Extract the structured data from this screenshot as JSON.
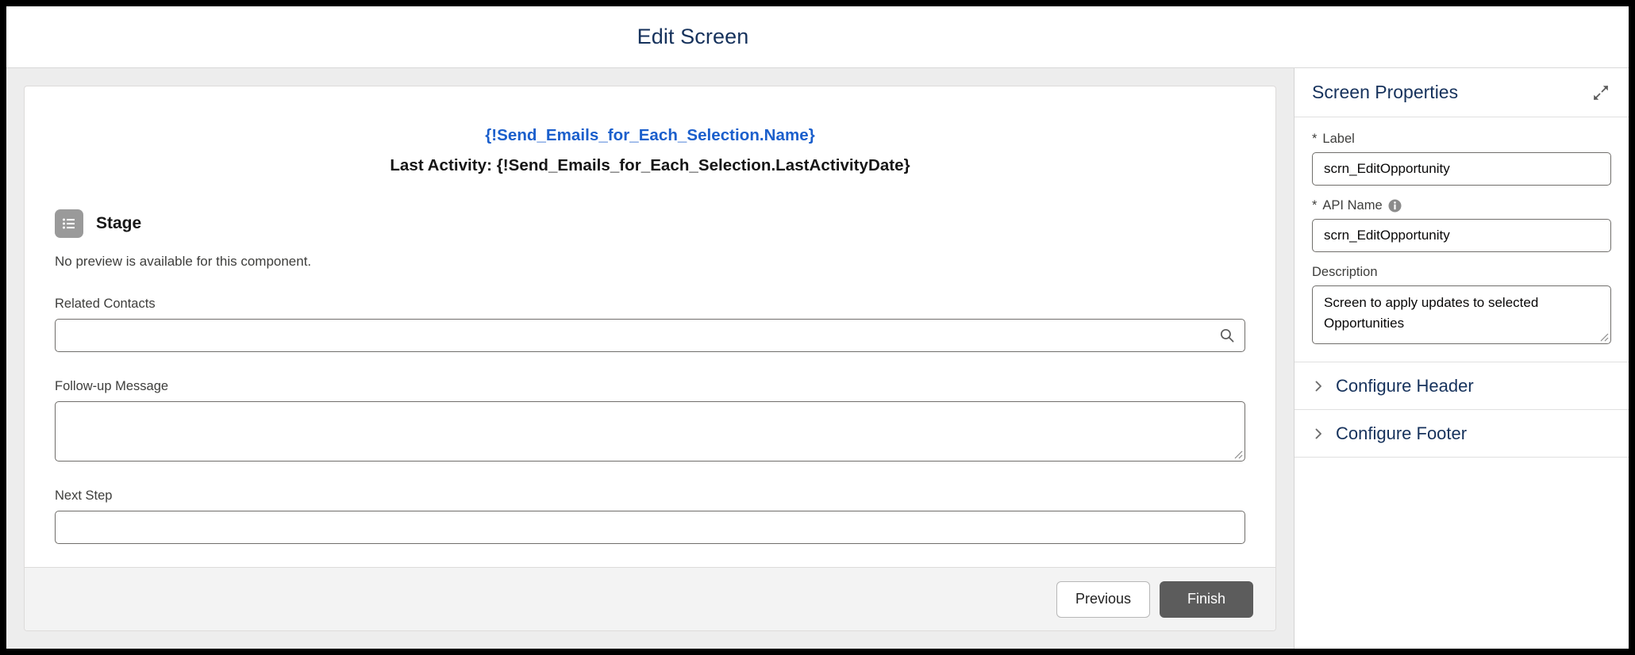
{
  "window": {
    "title": "Edit Screen"
  },
  "canvas": {
    "heading_primary": "{!Send_Emails_for_Each_Selection.Name}",
    "heading_secondary": "Last Activity: {!Send_Emails_for_Each_Selection.LastActivityDate}",
    "stage": {
      "icon": "list-icon",
      "title": "Stage",
      "note": "No preview is available for this component."
    },
    "fields": [
      {
        "label": "Related Contacts",
        "type": "lookup",
        "value": "",
        "placeholder": "",
        "icon": "search-icon"
      },
      {
        "label": "Follow-up Message",
        "type": "textarea",
        "value": "",
        "placeholder": ""
      },
      {
        "label": "Next Step",
        "type": "text",
        "value": "",
        "placeholder": ""
      }
    ],
    "footer": {
      "previous_label": "Previous",
      "finish_label": "Finish"
    }
  },
  "properties": {
    "header_title": "Screen Properties",
    "expand_icon": "expand-arrows-icon",
    "label_field": {
      "required_marker": "*",
      "label": "Label",
      "value": "scrn_EditOpportunity",
      "placeholder": ""
    },
    "api_name_field": {
      "required_marker": "*",
      "label": "API Name",
      "info_icon": "info-icon",
      "value": "scrn_EditOpportunity",
      "placeholder": ""
    },
    "description_field": {
      "label": "Description",
      "value": "Screen to apply updates to selected Opportunities",
      "placeholder": ""
    },
    "sections": [
      {
        "label": "Configure Header",
        "icon": "chevron-right-icon",
        "expanded": false
      },
      {
        "label": "Configure Footer",
        "icon": "chevron-right-icon",
        "expanded": false
      }
    ]
  },
  "colors": {
    "accent_merge_field": "#1b5fcc",
    "title_text": "#16325c",
    "canvas_bg": "#ededed",
    "brand_button": "#5c5c5c"
  }
}
